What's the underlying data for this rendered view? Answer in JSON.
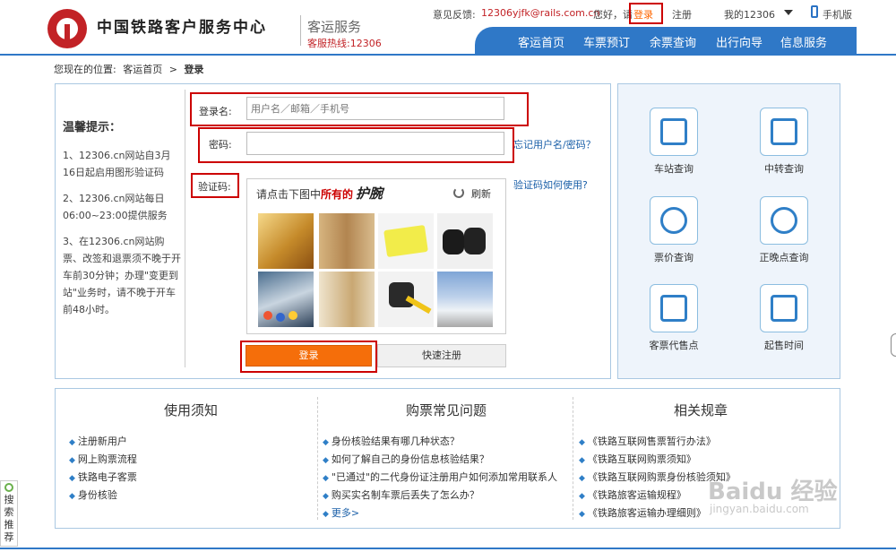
{
  "header": {
    "site_title": "中国铁路客户服务中心",
    "sub_title": "客运服务",
    "hotline": "客服热线:12306",
    "feedback_label": "意见反馈:",
    "feedback_email": "12306yjfk@rails.com.cn",
    "greeting": "您好，请",
    "login": "登录",
    "register": "注册",
    "my_account": "我的12306",
    "mobile": "手机版",
    "nav": [
      "客运首页",
      "车票预订",
      "余票查询",
      "出行向导",
      "信息服务"
    ]
  },
  "breadcrumb": {
    "prefix": "您现在的位置:",
    "home": "客运首页",
    "sep": ">",
    "current": "登录"
  },
  "tips": {
    "title": "温馨提示：",
    "items": [
      "1、12306.cn网站自3月16日起启用图形验证码",
      "2、12306.cn网站每日06:00~23:00提供服务",
      "3、在12306.cn网站购票、改签和退票须不晚于开车前30分钟；办理\"变更到站\"业务时，请不晚于开车前48小时。"
    ]
  },
  "form": {
    "username_label": "登录名:",
    "username_placeholder": "用户名／邮箱／手机号",
    "password_label": "密码:",
    "forgot_link": "忘记用户名/密码？",
    "captcha_label": "验证码:",
    "captcha_help": "验证码如何使用?",
    "captcha_prompt_pre": "请点击下图中",
    "captcha_prompt_hl": "所有的",
    "captcha_word": "护腕",
    "refresh": "刷新",
    "login_button": "登录",
    "register_button": "快速注册"
  },
  "quick_services": [
    "车站查询",
    "中转查询",
    "票价查询",
    "正晚点查询",
    "客票代售点",
    "起售时间"
  ],
  "info": {
    "col1": {
      "title": "使用须知",
      "items": [
        "注册新用户",
        "网上购票流程",
        "铁路电子客票",
        "身份核验"
      ]
    },
    "col2": {
      "title": "购票常见问题",
      "items": [
        "身份核验结果有哪几种状态？",
        "如何了解自己的身份信息核验结果？",
        "\"已通过\"的二代身份证注册用户如何添加常用联系人",
        "购买实名制车票后丢失了怎么办？"
      ],
      "more": "更多>"
    },
    "col3": {
      "title": "相关规章",
      "items": [
        "《铁路互联网售票暂行办法》",
        "《铁路互联网购票须知》",
        "《铁路互联网购票身份核验须知》",
        "《铁路旅客运输规程》",
        "《铁路旅客运输办理细则》"
      ]
    }
  },
  "watermark": "Baidu 经验",
  "watermark_url": "jingyan.baidu.com",
  "side_search": "搜索推荐",
  "colors": {
    "brand_red": "#c22226",
    "nav_blue": "#2f78c7",
    "button_orange": "#f56e0a",
    "highlight_box": "#cc0000"
  }
}
